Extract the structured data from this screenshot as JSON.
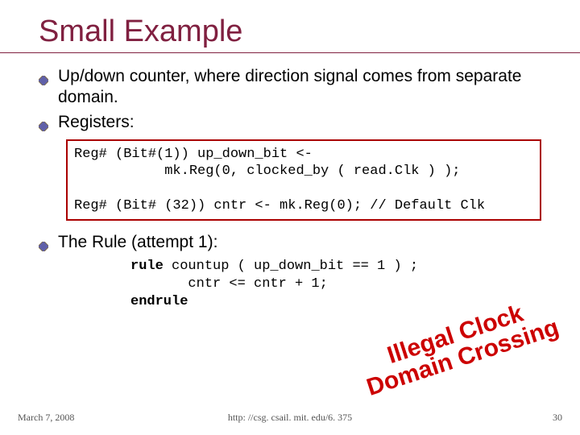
{
  "title": "Small Example",
  "bullets": {
    "b1": "Up/down counter, where direction signal comes from separate domain.",
    "b2": "Registers:",
    "b3": "The Rule (attempt 1):"
  },
  "code1_line1": "Reg# (Bit#(1)) up_down_bit <-",
  "code1_line2": "           mk.Reg(0, clocked_by ( read.Clk ) );",
  "code1_line3": "",
  "code1_line4": "Reg# (Bit# (32)) cntr <- mk.Reg(0); // Default Clk",
  "code2_kw_rule": "rule",
  "code2_rule_rest": " countup ( up_down_bit == 1 ) ;",
  "code2_body": "       cntr <= cntr + 1;",
  "code2_kw_end": "endrule",
  "overlay_line1": "Illegal Clock",
  "overlay_line2": "Domain Crossing",
  "footer": {
    "date": "March 7, 2008",
    "url": "http: //csg. csail. mit. edu/6. 375",
    "page": "30"
  }
}
